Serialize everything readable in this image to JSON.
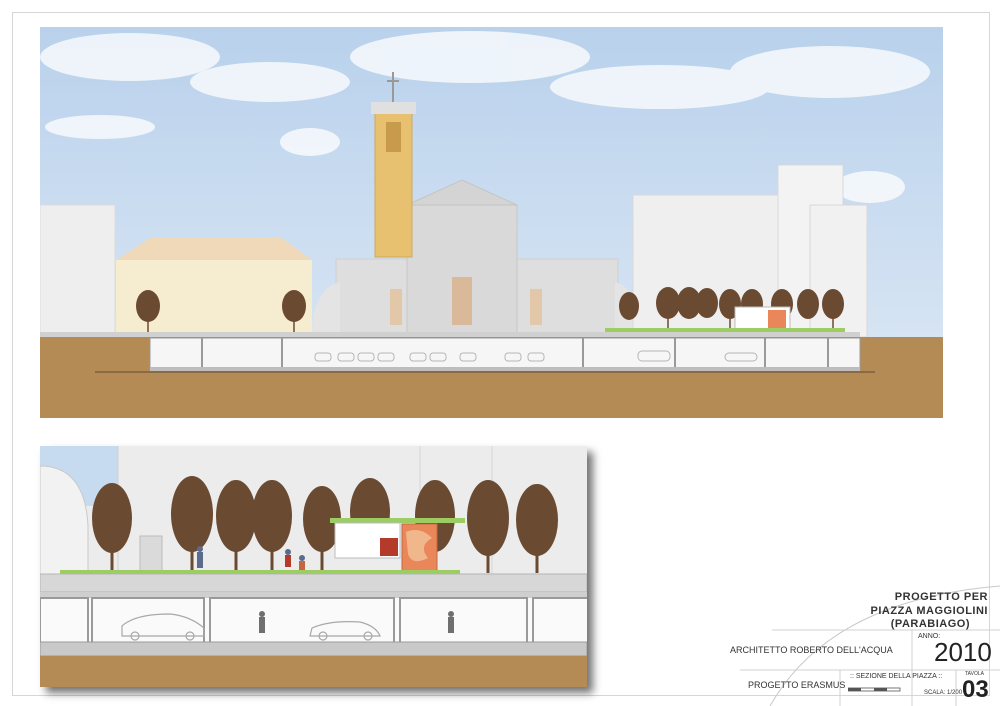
{
  "title_block": {
    "project_line1": "PROGETTO PER",
    "project_line2": "PIAZZA MAGGIOLINI",
    "project_line3": "(PARABIAGO)",
    "architect": "ARCHITETTO ROBERTO DELL'ACQUA",
    "year_label": "ANNO:",
    "year": "2010",
    "sheet_label": "TAVOLA",
    "sheet_number": "03",
    "program": "PROGETTO ERASMUS",
    "drawing_title": ":: SEZIONE DELLA PIAZZA ::",
    "scale_text": "SCALA: 1/200"
  },
  "colors": {
    "sky": "#c7dbf0",
    "ground": "#b48b54",
    "bell_tower": "#e7c16f",
    "tree_canopy": "#6b4a32",
    "lawn": "#9ccd63"
  }
}
